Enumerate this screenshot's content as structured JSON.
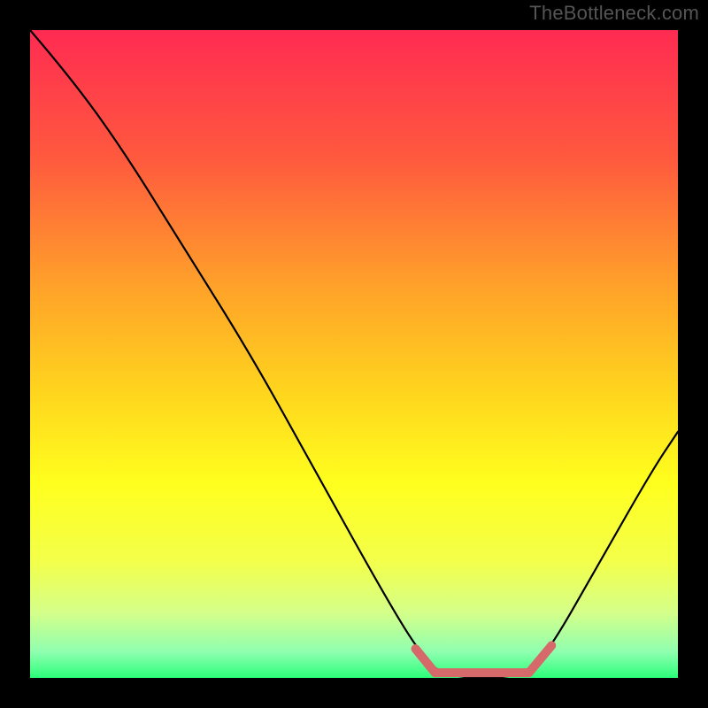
{
  "watermark": "TheBottleneck.com",
  "frame": {
    "margin": 34,
    "stroke": "#000000",
    "stroke_width": 3
  },
  "gradient": {
    "stops": [
      {
        "offset": 0.0,
        "color": "#ff2b52"
      },
      {
        "offset": 0.2,
        "color": "#ff5a3e"
      },
      {
        "offset": 0.4,
        "color": "#ffa329"
      },
      {
        "offset": 0.55,
        "color": "#ffd21e"
      },
      {
        "offset": 0.7,
        "color": "#ffff1e"
      },
      {
        "offset": 0.82,
        "color": "#f3ff4a"
      },
      {
        "offset": 0.9,
        "color": "#d4ff8a"
      },
      {
        "offset": 0.96,
        "color": "#8fffb0"
      },
      {
        "offset": 1.0,
        "color": "#2bff7a"
      }
    ]
  },
  "curve": {
    "xmin": 0,
    "xmax": 100,
    "points": [
      {
        "x": 0,
        "y": 100
      },
      {
        "x": 6,
        "y": 93
      },
      {
        "x": 14,
        "y": 82
      },
      {
        "x": 24,
        "y": 66
      },
      {
        "x": 34,
        "y": 50
      },
      {
        "x": 44,
        "y": 32
      },
      {
        "x": 54,
        "y": 14
      },
      {
        "x": 60,
        "y": 4
      },
      {
        "x": 64,
        "y": 0
      },
      {
        "x": 76,
        "y": 0
      },
      {
        "x": 80,
        "y": 4
      },
      {
        "x": 88,
        "y": 18
      },
      {
        "x": 96,
        "y": 32
      },
      {
        "x": 100,
        "y": 38
      }
    ]
  },
  "bottom_marker": {
    "color": "#d66a6a",
    "thickness": 10,
    "segments": [
      {
        "x0": 59.5,
        "y0": 4.5,
        "x1": 62.5,
        "y1": 0.8
      },
      {
        "x0": 62.5,
        "y0": 0.8,
        "x1": 77.0,
        "y1": 0.8
      },
      {
        "x0": 77.0,
        "y0": 0.8,
        "x1": 80.5,
        "y1": 5.0
      }
    ]
  },
  "chart_data": {
    "type": "line",
    "title": "",
    "xlabel": "",
    "ylabel": "",
    "xlim": [
      0,
      100
    ],
    "ylim": [
      0,
      100
    ],
    "x": [
      0,
      6,
      14,
      24,
      34,
      44,
      54,
      60,
      64,
      76,
      80,
      88,
      96,
      100
    ],
    "y": [
      100,
      93,
      82,
      66,
      50,
      32,
      14,
      4,
      0,
      0,
      4,
      18,
      32,
      38
    ],
    "highlight_x_range": [
      60,
      80
    ],
    "annotations": [
      "TheBottleneck.com"
    ]
  }
}
